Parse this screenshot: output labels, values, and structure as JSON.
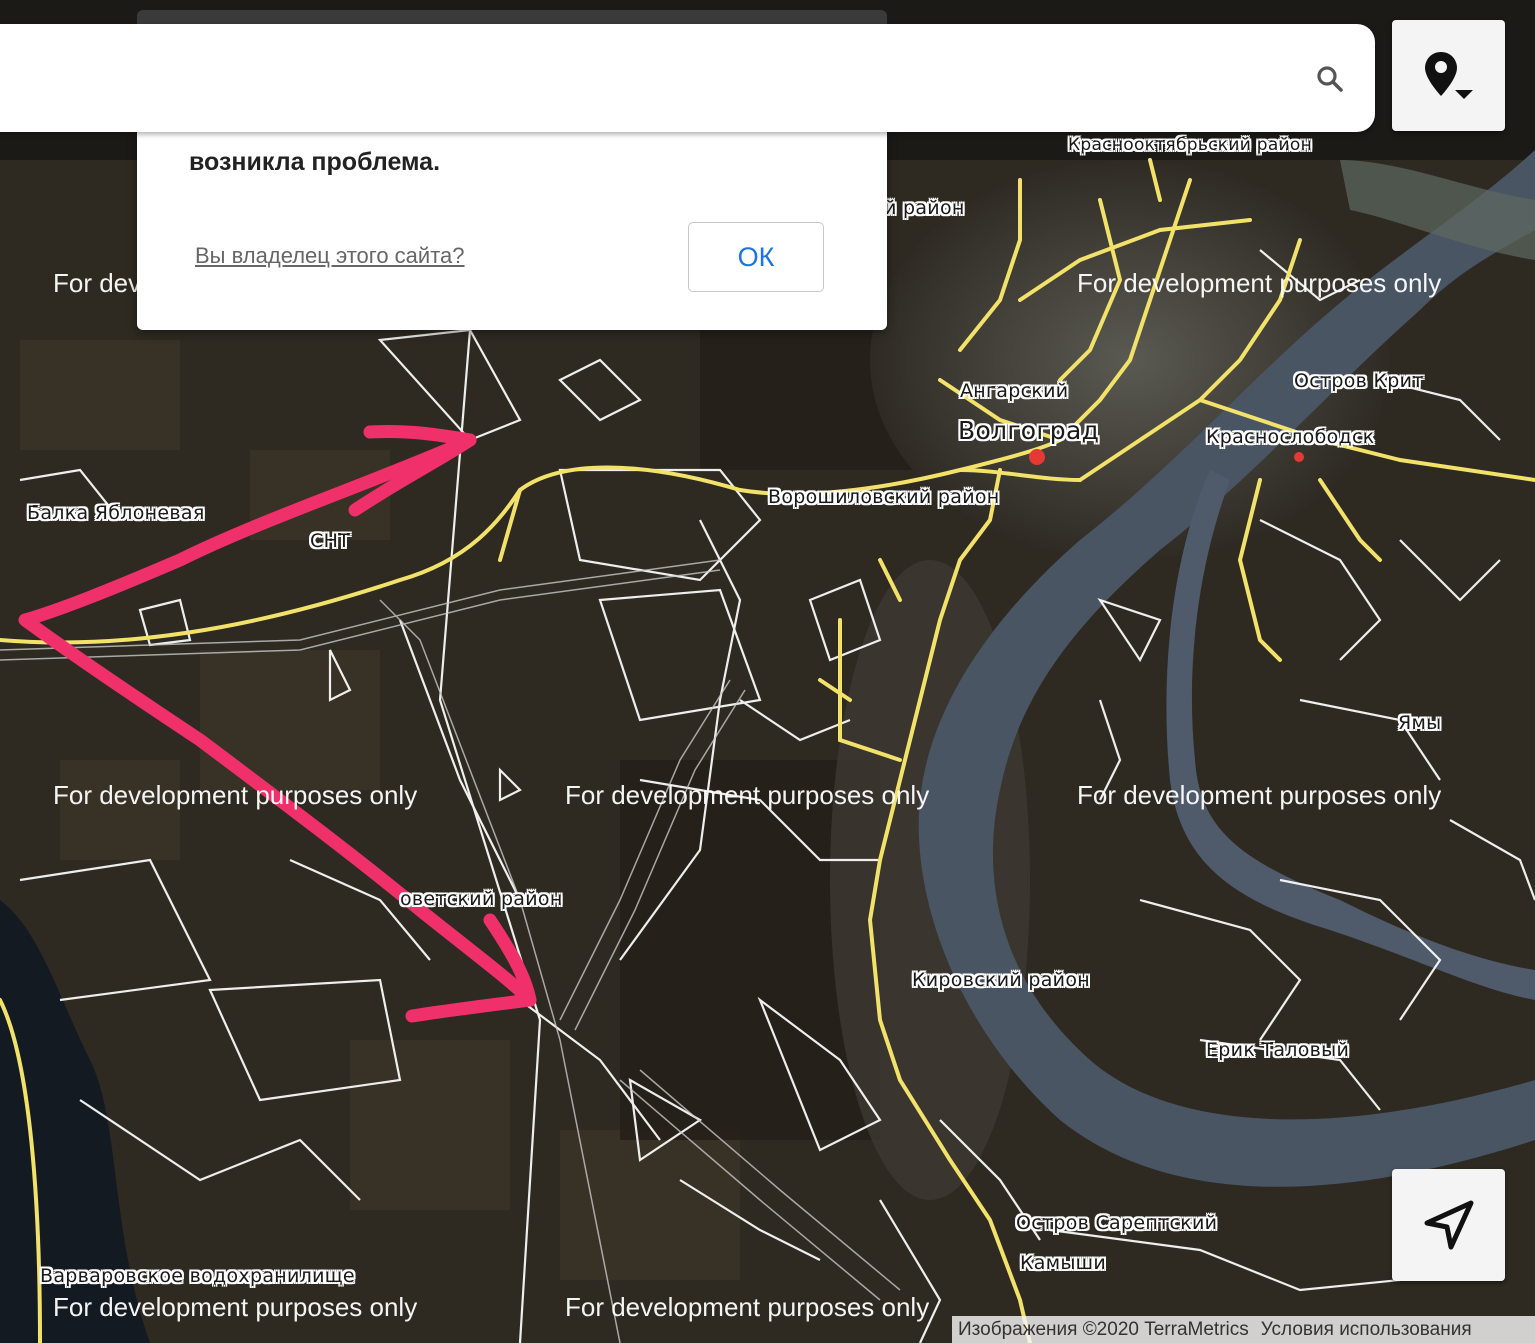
{
  "map": {
    "type": "satellite",
    "places": [
      {
        "id": "krasnooktyabrsky",
        "text": "Краснооктябрьский район"
      },
      {
        "id": "rayon-top",
        "text": "й район"
      },
      {
        "id": "angarsky",
        "text": "Ангарский"
      },
      {
        "id": "volgograd",
        "text": "Волгоград"
      },
      {
        "id": "ostrov-krit",
        "text": "Остров Крит"
      },
      {
        "id": "krasnoslobodsk",
        "text": "Краснослободск"
      },
      {
        "id": "voroshilovsky",
        "text": "Ворошиловский район"
      },
      {
        "id": "balka",
        "text": "Балка Яблоневая"
      },
      {
        "id": "snt",
        "text": "СНТ"
      },
      {
        "id": "yamy",
        "text": "Ямы"
      },
      {
        "id": "sovetsky",
        "text": "оветский район"
      },
      {
        "id": "kirovsky",
        "text": "Кировский район"
      },
      {
        "id": "erik",
        "text": "Ерик Таловый"
      },
      {
        "id": "sareptsky",
        "text": "Остров Сарептский"
      },
      {
        "id": "kamyshi",
        "text": "Камыши"
      },
      {
        "id": "varvarovskoe",
        "text": "Варваровское водохранилище"
      }
    ],
    "watermark_text": "For development purposes only",
    "colors": {
      "terrain": "#2e2a22",
      "roads": "#f2e26a",
      "river": "#4a5564",
      "boundaries": "#ffffff",
      "annotation_arrow": "#f0306a"
    }
  },
  "search": {
    "icon": "search-icon"
  },
  "location_button": {
    "icon": "location-pin-dropdown-icon"
  },
  "navigate_button": {
    "icon": "navigation-arrow-icon"
  },
  "dialog": {
    "message": "возникла проблема.",
    "owner_link": "Вы владелец этого сайта?",
    "ok_label": "ОК"
  },
  "attribution": {
    "imagery": "Изображения ©2020 TerraMetrics",
    "terms": "Условия использования"
  }
}
